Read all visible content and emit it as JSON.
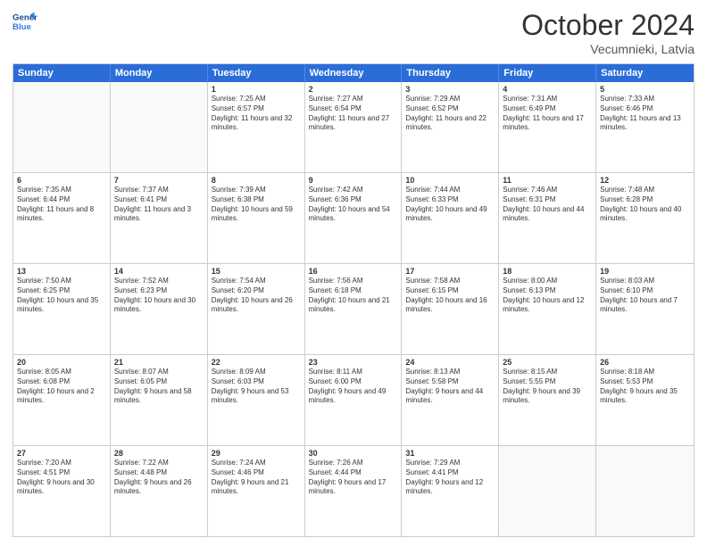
{
  "header": {
    "logo_line1": "General",
    "logo_line2": "Blue",
    "month": "October 2024",
    "location": "Vecumnieki, Latvia"
  },
  "days_of_week": [
    "Sunday",
    "Monday",
    "Tuesday",
    "Wednesday",
    "Thursday",
    "Friday",
    "Saturday"
  ],
  "weeks": [
    [
      {
        "day": "",
        "sunrise": "",
        "sunset": "",
        "daylight": ""
      },
      {
        "day": "",
        "sunrise": "",
        "sunset": "",
        "daylight": ""
      },
      {
        "day": "1",
        "sunrise": "Sunrise: 7:25 AM",
        "sunset": "Sunset: 6:57 PM",
        "daylight": "Daylight: 11 hours and 32 minutes."
      },
      {
        "day": "2",
        "sunrise": "Sunrise: 7:27 AM",
        "sunset": "Sunset: 6:54 PM",
        "daylight": "Daylight: 11 hours and 27 minutes."
      },
      {
        "day": "3",
        "sunrise": "Sunrise: 7:29 AM",
        "sunset": "Sunset: 6:52 PM",
        "daylight": "Daylight: 11 hours and 22 minutes."
      },
      {
        "day": "4",
        "sunrise": "Sunrise: 7:31 AM",
        "sunset": "Sunset: 6:49 PM",
        "daylight": "Daylight: 11 hours and 17 minutes."
      },
      {
        "day": "5",
        "sunrise": "Sunrise: 7:33 AM",
        "sunset": "Sunset: 6:46 PM",
        "daylight": "Daylight: 11 hours and 13 minutes."
      }
    ],
    [
      {
        "day": "6",
        "sunrise": "Sunrise: 7:35 AM",
        "sunset": "Sunset: 6:44 PM",
        "daylight": "Daylight: 11 hours and 8 minutes."
      },
      {
        "day": "7",
        "sunrise": "Sunrise: 7:37 AM",
        "sunset": "Sunset: 6:41 PM",
        "daylight": "Daylight: 11 hours and 3 minutes."
      },
      {
        "day": "8",
        "sunrise": "Sunrise: 7:39 AM",
        "sunset": "Sunset: 6:38 PM",
        "daylight": "Daylight: 10 hours and 59 minutes."
      },
      {
        "day": "9",
        "sunrise": "Sunrise: 7:42 AM",
        "sunset": "Sunset: 6:36 PM",
        "daylight": "Daylight: 10 hours and 54 minutes."
      },
      {
        "day": "10",
        "sunrise": "Sunrise: 7:44 AM",
        "sunset": "Sunset: 6:33 PM",
        "daylight": "Daylight: 10 hours and 49 minutes."
      },
      {
        "day": "11",
        "sunrise": "Sunrise: 7:46 AM",
        "sunset": "Sunset: 6:31 PM",
        "daylight": "Daylight: 10 hours and 44 minutes."
      },
      {
        "day": "12",
        "sunrise": "Sunrise: 7:48 AM",
        "sunset": "Sunset: 6:28 PM",
        "daylight": "Daylight: 10 hours and 40 minutes."
      }
    ],
    [
      {
        "day": "13",
        "sunrise": "Sunrise: 7:50 AM",
        "sunset": "Sunset: 6:25 PM",
        "daylight": "Daylight: 10 hours and 35 minutes."
      },
      {
        "day": "14",
        "sunrise": "Sunrise: 7:52 AM",
        "sunset": "Sunset: 6:23 PM",
        "daylight": "Daylight: 10 hours and 30 minutes."
      },
      {
        "day": "15",
        "sunrise": "Sunrise: 7:54 AM",
        "sunset": "Sunset: 6:20 PM",
        "daylight": "Daylight: 10 hours and 26 minutes."
      },
      {
        "day": "16",
        "sunrise": "Sunrise: 7:56 AM",
        "sunset": "Sunset: 6:18 PM",
        "daylight": "Daylight: 10 hours and 21 minutes."
      },
      {
        "day": "17",
        "sunrise": "Sunrise: 7:58 AM",
        "sunset": "Sunset: 6:15 PM",
        "daylight": "Daylight: 10 hours and 16 minutes."
      },
      {
        "day": "18",
        "sunrise": "Sunrise: 8:00 AM",
        "sunset": "Sunset: 6:13 PM",
        "daylight": "Daylight: 10 hours and 12 minutes."
      },
      {
        "day": "19",
        "sunrise": "Sunrise: 8:03 AM",
        "sunset": "Sunset: 6:10 PM",
        "daylight": "Daylight: 10 hours and 7 minutes."
      }
    ],
    [
      {
        "day": "20",
        "sunrise": "Sunrise: 8:05 AM",
        "sunset": "Sunset: 6:08 PM",
        "daylight": "Daylight: 10 hours and 2 minutes."
      },
      {
        "day": "21",
        "sunrise": "Sunrise: 8:07 AM",
        "sunset": "Sunset: 6:05 PM",
        "daylight": "Daylight: 9 hours and 58 minutes."
      },
      {
        "day": "22",
        "sunrise": "Sunrise: 8:09 AM",
        "sunset": "Sunset: 6:03 PM",
        "daylight": "Daylight: 9 hours and 53 minutes."
      },
      {
        "day": "23",
        "sunrise": "Sunrise: 8:11 AM",
        "sunset": "Sunset: 6:00 PM",
        "daylight": "Daylight: 9 hours and 49 minutes."
      },
      {
        "day": "24",
        "sunrise": "Sunrise: 8:13 AM",
        "sunset": "Sunset: 5:58 PM",
        "daylight": "Daylight: 9 hours and 44 minutes."
      },
      {
        "day": "25",
        "sunrise": "Sunrise: 8:15 AM",
        "sunset": "Sunset: 5:55 PM",
        "daylight": "Daylight: 9 hours and 39 minutes."
      },
      {
        "day": "26",
        "sunrise": "Sunrise: 8:18 AM",
        "sunset": "Sunset: 5:53 PM",
        "daylight": "Daylight: 9 hours and 35 minutes."
      }
    ],
    [
      {
        "day": "27",
        "sunrise": "Sunrise: 7:20 AM",
        "sunset": "Sunset: 4:51 PM",
        "daylight": "Daylight: 9 hours and 30 minutes."
      },
      {
        "day": "28",
        "sunrise": "Sunrise: 7:22 AM",
        "sunset": "Sunset: 4:48 PM",
        "daylight": "Daylight: 9 hours and 26 minutes."
      },
      {
        "day": "29",
        "sunrise": "Sunrise: 7:24 AM",
        "sunset": "Sunset: 4:46 PM",
        "daylight": "Daylight: 9 hours and 21 minutes."
      },
      {
        "day": "30",
        "sunrise": "Sunrise: 7:26 AM",
        "sunset": "Sunset: 4:44 PM",
        "daylight": "Daylight: 9 hours and 17 minutes."
      },
      {
        "day": "31",
        "sunrise": "Sunrise: 7:29 AM",
        "sunset": "Sunset: 4:41 PM",
        "daylight": "Daylight: 9 hours and 12 minutes."
      },
      {
        "day": "",
        "sunrise": "",
        "sunset": "",
        "daylight": ""
      },
      {
        "day": "",
        "sunrise": "",
        "sunset": "",
        "daylight": ""
      }
    ]
  ]
}
